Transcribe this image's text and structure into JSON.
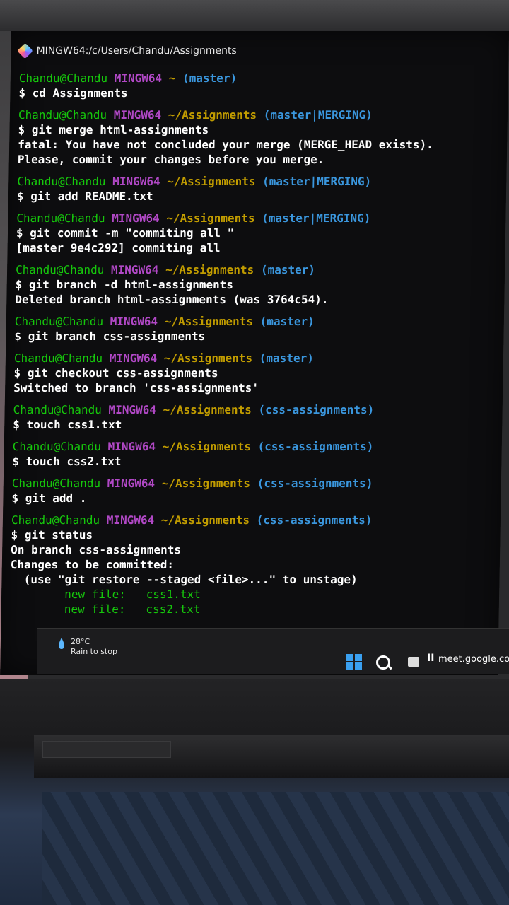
{
  "window": {
    "title": "MINGW64:/c/Users/Chandu/Assignments"
  },
  "terminal": {
    "blocks": [
      {
        "user": "Chandu@Chandu",
        "host": "MINGW64",
        "path": "~",
        "branch": "(master)",
        "lines": [
          "$ cd Assignments"
        ]
      },
      {
        "user": "Chandu@Chandu",
        "host": "MINGW64",
        "path": "~/Assignments",
        "branch": "(master|MERGING)",
        "lines": [
          "$ git merge html-assignments",
          "fatal: You have not concluded your merge (MERGE_HEAD exists).",
          "Please, commit your changes before you merge."
        ]
      },
      {
        "user": "Chandu@Chandu",
        "host": "MINGW64",
        "path": "~/Assignments",
        "branch": "(master|MERGING)",
        "lines": [
          "$ git add README.txt"
        ]
      },
      {
        "user": "Chandu@Chandu",
        "host": "MINGW64",
        "path": "~/Assignments",
        "branch": "(master|MERGING)",
        "lines": [
          "$ git commit -m \"commiting all \"",
          "[master 9e4c292] commiting all"
        ]
      },
      {
        "user": "Chandu@Chandu",
        "host": "MINGW64",
        "path": "~/Assignments",
        "branch": "(master)",
        "lines": [
          "$ git branch -d html-assignments",
          "Deleted branch html-assignments (was 3764c54)."
        ]
      },
      {
        "user": "Chandu@Chandu",
        "host": "MINGW64",
        "path": "~/Assignments",
        "branch": "(master)",
        "lines": [
          "$ git branch css-assignments"
        ]
      },
      {
        "user": "Chandu@Chandu",
        "host": "MINGW64",
        "path": "~/Assignments",
        "branch": "(master)",
        "lines": [
          "$ git checkout css-assignments",
          "Switched to branch 'css-assignments'"
        ]
      },
      {
        "user": "Chandu@Chandu",
        "host": "MINGW64",
        "path": "~/Assignments",
        "branch": "(css-assignments)",
        "lines": [
          "$ touch css1.txt"
        ]
      },
      {
        "user": "Chandu@Chandu",
        "host": "MINGW64",
        "path": "~/Assignments",
        "branch": "(css-assignments)",
        "lines": [
          "$ touch css2.txt"
        ]
      },
      {
        "user": "Chandu@Chandu",
        "host": "MINGW64",
        "path": "~/Assignments",
        "branch": "(css-assignments)",
        "lines": [
          "$ git add ."
        ]
      },
      {
        "user": "Chandu@Chandu",
        "host": "MINGW64",
        "path": "~/Assignments",
        "branch": "(css-assignments)",
        "lines": [
          "$ git status",
          "On branch css-assignments",
          "Changes to be committed:",
          "  (use \"git restore --staged <file>...\" to unstage)"
        ],
        "staged": [
          {
            "label": "new file:",
            "file": "css1.txt"
          },
          {
            "label": "new file:",
            "file": "css2.txt"
          }
        ]
      }
    ]
  },
  "taskbar": {
    "weather_temp": "28°C",
    "weather_desc": "Rain to stop",
    "active_tab": "meet.google.com",
    "pause_glyph": "II"
  },
  "colors": {
    "user": "#16c60c",
    "host": "#b148c6",
    "path": "#c19c00",
    "branch": "#3a96dd"
  }
}
